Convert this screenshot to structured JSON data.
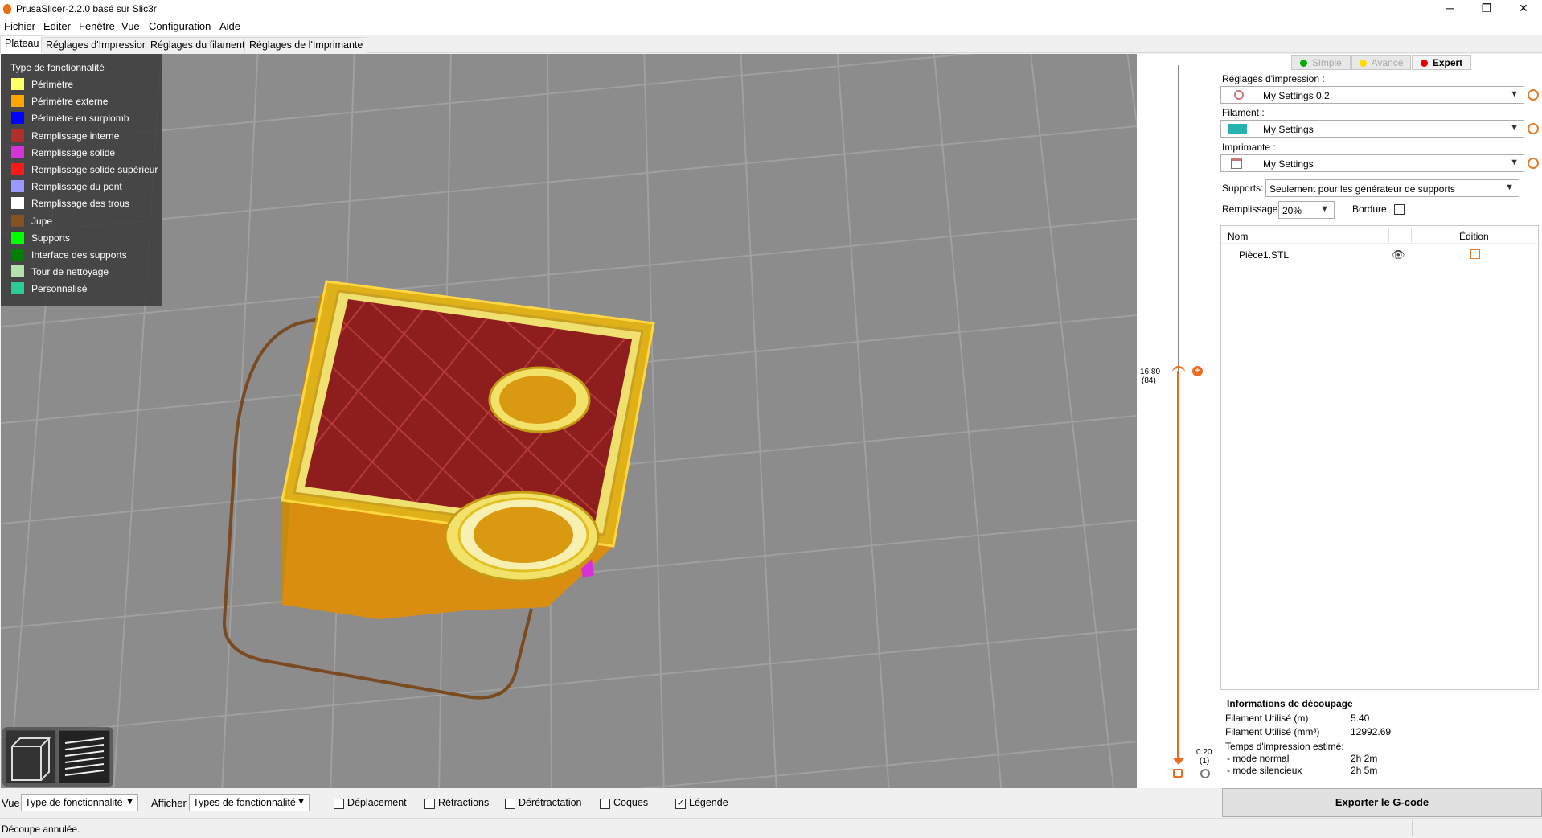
{
  "window": {
    "title": "PrusaSlicer-2.2.0 basé sur Slic3r",
    "minimize": "─",
    "maximize": "❐",
    "close": "✕"
  },
  "menu": [
    "Fichier",
    "Editer",
    "Fenêtre",
    "Vue",
    "Configuration",
    "Aide"
  ],
  "tabs": [
    "Plateau",
    "Réglages d'Impression",
    "Réglages du filament",
    "Réglages de l'Imprimante"
  ],
  "legend": {
    "title": "Type de fonctionnalité",
    "items": [
      {
        "label": "Périmètre",
        "color": "#ffff66"
      },
      {
        "label": "Périmètre externe",
        "color": "#ffa500"
      },
      {
        "label": "Périmètre en surplomb",
        "color": "#0000ff"
      },
      {
        "label": "Remplissage interne",
        "color": "#b03029"
      },
      {
        "label": "Remplissage solide",
        "color": "#d732d7"
      },
      {
        "label": "Remplissage solide supérieur",
        "color": "#ff1a1a"
      },
      {
        "label": "Remplissage du pont",
        "color": "#9999ff"
      },
      {
        "label": "Remplissage des trous",
        "color": "#ffffff"
      },
      {
        "label": "Jupe",
        "color": "#845321"
      },
      {
        "label": "Supports",
        "color": "#00ff00"
      },
      {
        "label": "Interface des supports",
        "color": "#008000"
      },
      {
        "label": "Tour de nettoyage",
        "color": "#b3e3ab"
      },
      {
        "label": "Personnalisé",
        "color": "#28cc94"
      }
    ]
  },
  "layer_slider": {
    "top_value": "16.80",
    "top_layer": "(84)",
    "bottom_value": "0.20",
    "bottom_layer": "(1)",
    "accent": "#ed6b21"
  },
  "sidebar": {
    "modes": [
      {
        "label": "Simple",
        "color": "#00b000",
        "active": false
      },
      {
        "label": "Avancé",
        "color": "#ffdc00",
        "active": false
      },
      {
        "label": "Expert",
        "color": "#e70000",
        "active": true
      }
    ],
    "print_settings_label": "Réglages d'impression :",
    "print_settings_value": "My Settings 0.2",
    "filament_label": "Filament :",
    "filament_value": "My Settings",
    "filament_color": "#29b2b2",
    "printer_label": "Imprimante :",
    "printer_value": "My Settings",
    "supports_label": "Supports:",
    "supports_value": "Seulement pour les générateur de supports",
    "infill_label": "Remplissage:",
    "infill_value": "20%",
    "brim_label": "Bordure:",
    "object_list": {
      "col_name": "Nom",
      "col_edit": "Édition",
      "rows": [
        {
          "name": "Pièce1.STL"
        }
      ]
    },
    "slice_info": {
      "title": "Informations de découpage",
      "rows": [
        {
          "label": "Filament Utilisé (m)",
          "value": "5.40"
        },
        {
          "label": "Filament Utilisé (mm³)",
          "value": "12992.69"
        },
        {
          "label": "Temps d'impression estimé:",
          "value": ""
        },
        {
          "label": "- mode normal",
          "value": "2h 2m"
        },
        {
          "label": "- mode silencieux",
          "value": "2h 5m"
        }
      ]
    },
    "export_label": "Exporter le G-code"
  },
  "bottom": {
    "view_label": "Vue",
    "view_value": "Type de fonctionnalité",
    "show_label": "Afficher",
    "show_value": "Types de fonctionnalité",
    "checkboxes": [
      {
        "label": "Déplacement",
        "checked": false
      },
      {
        "label": "Rétractions",
        "checked": false
      },
      {
        "label": "Dérétractation",
        "checked": false
      },
      {
        "label": "Coques",
        "checked": false
      },
      {
        "label": "Légende",
        "checked": true
      }
    ]
  },
  "status": "Découpe annulée."
}
